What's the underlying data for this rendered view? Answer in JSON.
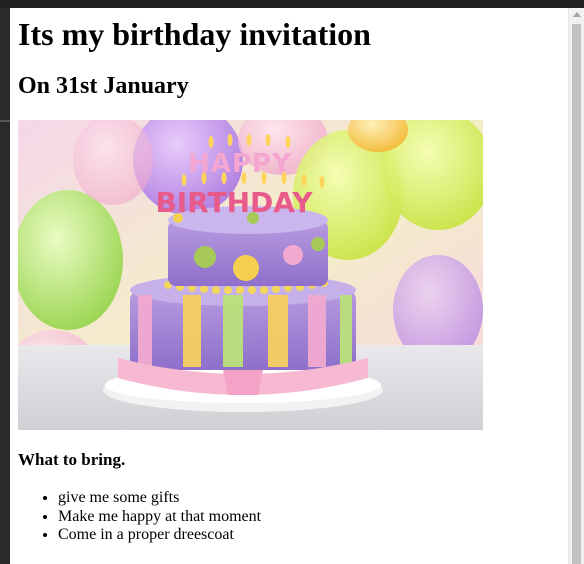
{
  "page": {
    "title": "Its my birthday invitation",
    "date_heading": "On 31st January",
    "image": {
      "alt": "birthday cake with HAPPY BIRTHDAY candles",
      "candles_text_1": "HAPPY",
      "candles_text_2": "BIRTHDAY"
    },
    "bring_heading": "What to bring.",
    "bring_items": [
      "give me some gifts",
      "Make me happy at that moment",
      "Come in a proper dreescoat"
    ]
  },
  "colors": {
    "background": "#ffffff",
    "text": "#000000",
    "scrollbar_track": "#f1f1f1",
    "scrollbar_thumb": "#c1c1c1"
  }
}
